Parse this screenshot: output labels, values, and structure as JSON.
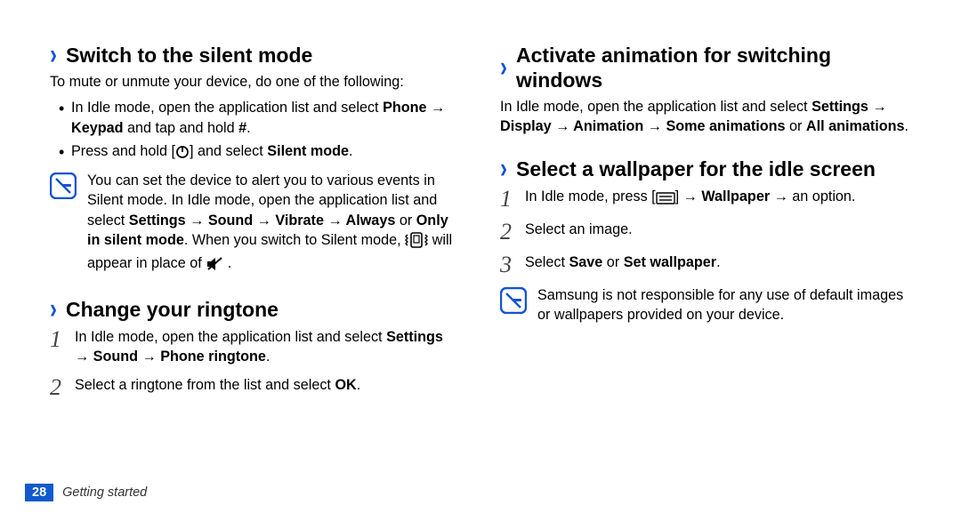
{
  "left": {
    "silent": {
      "heading": "Switch to the silent mode",
      "intro": "To mute or unmute your device, do one of the following:",
      "bullet1_a": "In Idle mode, open the application list and select ",
      "bullet1_b_phone": "Phone",
      "bullet1_c": " → ",
      "bullet1_d_keypad": "Keypad",
      "bullet1_e": " and tap and hold ",
      "bullet1_f_hash": "#",
      "bullet1_g": ".",
      "bullet2_a": "Press and hold [",
      "bullet2_b": "] and select ",
      "bullet2_c_silent": "Silent mode",
      "bullet2_d": ".",
      "note_a": "You can set the device to alert you to various events in Silent mode. In Idle mode, open the application list and select ",
      "note_b_path": "Settings → Sound → Vibrate → Always",
      "note_c": " or ",
      "note_d_only": "Only in silent mode",
      "note_e": ". When you switch to Silent mode, ",
      "note_f": " will appear in place of ",
      "note_g": " ."
    },
    "ringtone": {
      "heading": "Change your ringtone",
      "step1_a": "In Idle mode, open the application list and select ",
      "step1_b_path": "Settings → Sound → Phone ringtone",
      "step1_c": ".",
      "step2_a": "Select a ringtone from the list and select ",
      "step2_b_ok": "OK",
      "step2_c": "."
    }
  },
  "right": {
    "anim": {
      "heading": "Activate animation for switching windows",
      "para_a": "In Idle mode, open the application list and select ",
      "para_b_path": "Settings → Display → Animation → Some animations",
      "para_c": " or ",
      "para_d_all": "All animations",
      "para_e": "."
    },
    "wallpaper": {
      "heading": "Select a wallpaper for the idle screen",
      "step1_a": "In Idle mode, press [",
      "step1_b": "] → ",
      "step1_c_wall": "Wallpaper",
      "step1_d": " → an option.",
      "step2": "Select an image.",
      "step3_a": "Select ",
      "step3_b_save": "Save",
      "step3_c": " or ",
      "step3_d_set": "Set wallpaper",
      "step3_e": ".",
      "note": "Samsung is not responsible for any use of default images or wallpapers provided on your device."
    }
  },
  "footer": {
    "page": "28",
    "section": "Getting started"
  },
  "steps": {
    "s1": "1",
    "s2": "2",
    "s3": "3"
  }
}
